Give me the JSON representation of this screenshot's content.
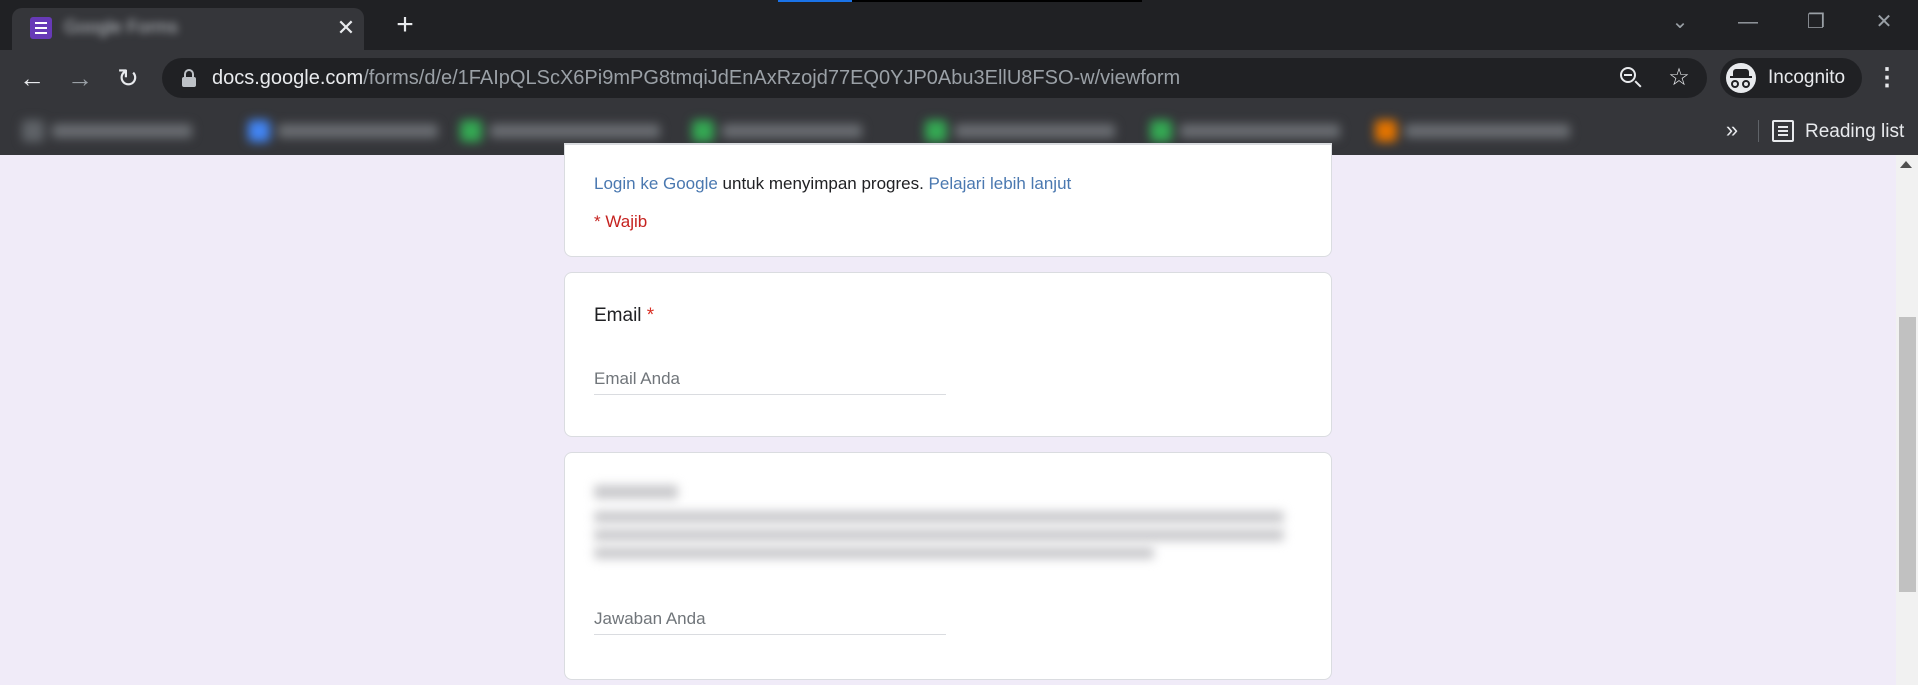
{
  "browser": {
    "tab": {
      "title": "Google Forms"
    },
    "new_tab_symbol": "+",
    "window_controls": {
      "minimize": "—",
      "restore": "❐",
      "close": "✕",
      "tab_search": "⌵"
    },
    "omnibox": {
      "host": "docs.google.com",
      "path": "/forms/d/e/1FAIpQLScX6Pi9mPG8tmqiJdEnAxRzojd77EQ0YJP0Abu3EllU8FSO-w/viewform"
    },
    "profile_label": "Incognito",
    "bookmarks_overflow": "»",
    "reading_list_label": "Reading list",
    "colors": {
      "frame": "#202124",
      "toolbar": "#35363a",
      "load_progress": "#1a73e8"
    }
  },
  "form": {
    "background_color": "#f0ebf8",
    "sign_in_notice": {
      "link_login": "Login ke Google",
      "middle_text": " untuk menyimpan progres. ",
      "link_learn": "Pelajari lebih lanjut"
    },
    "required_note": "* Wajib",
    "questions": [
      {
        "title": "Email",
        "required_marker": "*",
        "placeholder": "Email Anda"
      },
      {
        "placeholder": "Jawaban Anda"
      }
    ]
  }
}
